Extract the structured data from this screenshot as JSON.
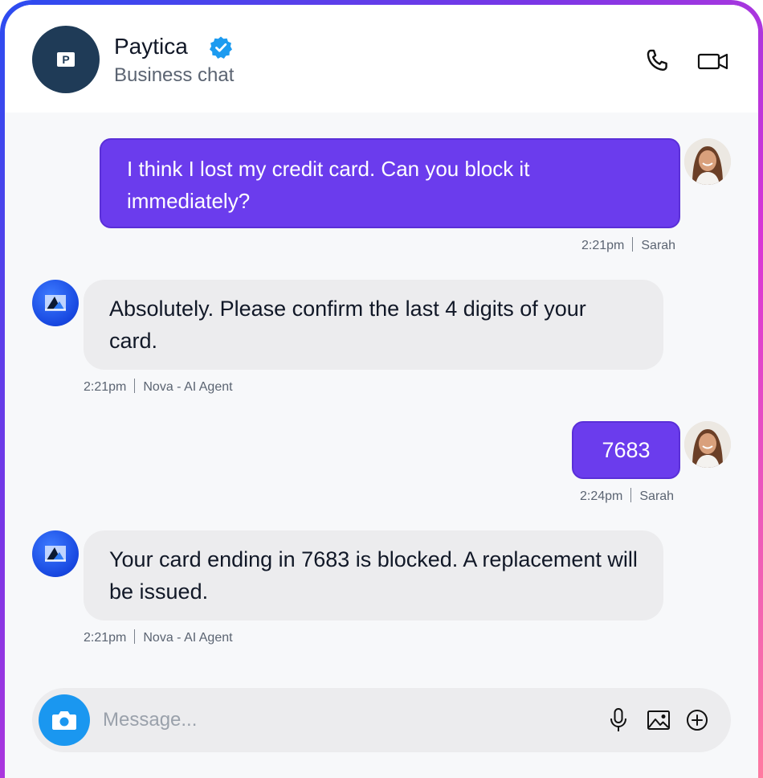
{
  "header": {
    "business_name": "Paytica",
    "subtitle": "Business chat",
    "logo_text": "P"
  },
  "messages": [
    {
      "direction": "outgoing",
      "text": "I think I lost my credit card. Can you block it immediately?",
      "time": "2:21pm",
      "sender": "Sarah"
    },
    {
      "direction": "incoming",
      "text": "Absolutely. Please confirm the last 4 digits of your card.",
      "time": "2:21pm",
      "sender": "Nova - AI Agent"
    },
    {
      "direction": "outgoing",
      "text": "7683",
      "time": "2:24pm",
      "sender": "Sarah"
    },
    {
      "direction": "incoming",
      "text": "Your card ending in 7683 is blocked. A replacement will be issued.",
      "time": "2:21pm",
      "sender": "Nova - AI Agent"
    }
  ],
  "composer": {
    "placeholder": "Message..."
  },
  "icons": {
    "call": "phone-icon",
    "video": "video-camera-icon",
    "verified": "verified-badge-icon",
    "camera": "camera-icon",
    "mic": "microphone-icon",
    "image": "image-icon",
    "add": "plus-circle-icon"
  },
  "colors": {
    "outgoing_bubble": "#6b3ced",
    "incoming_bubble": "#ececee",
    "accent_blue": "#1a97f0",
    "verified_blue": "#1d9bf0",
    "logo_bg": "#1f3b57"
  }
}
